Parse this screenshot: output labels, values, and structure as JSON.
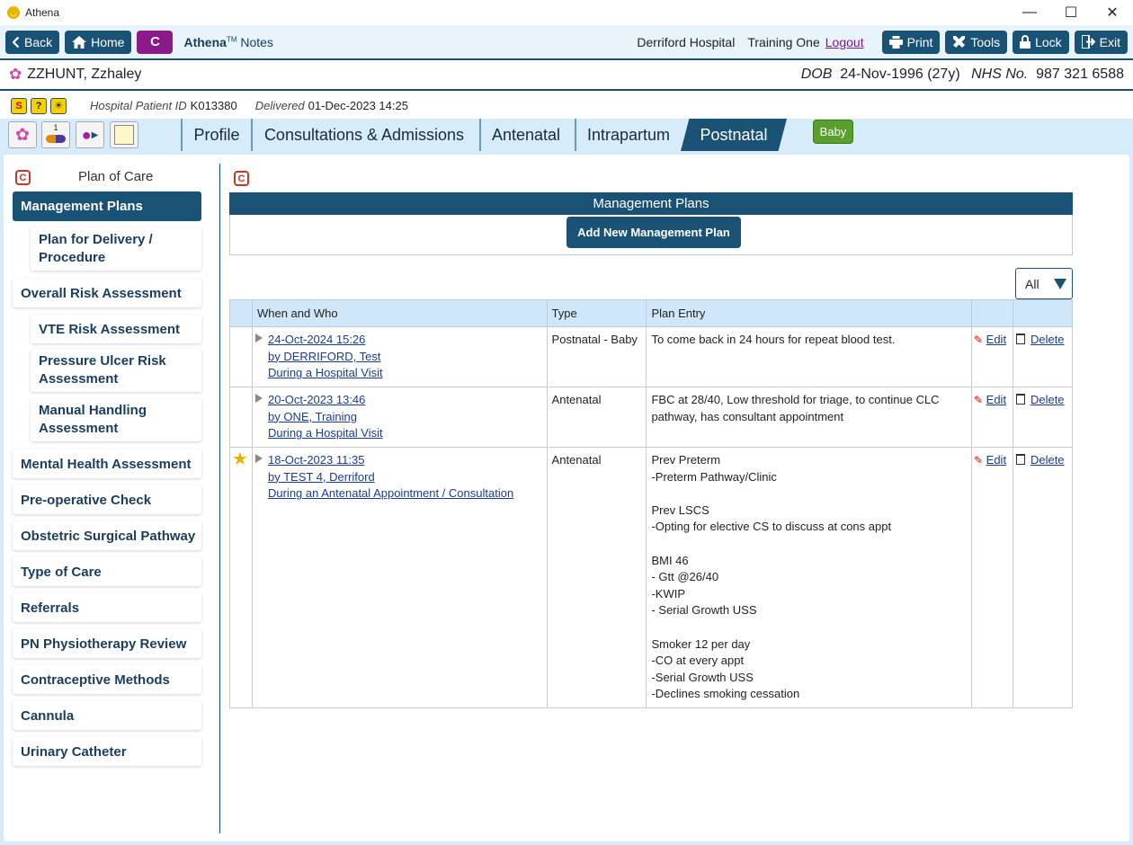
{
  "window": {
    "title": "Athena"
  },
  "toolbar": {
    "back": "Back",
    "home": "Home",
    "c": "C",
    "brand_name": "Athena",
    "brand_tm": "TM",
    "brand_suffix": "Notes",
    "hospital": "Derriford Hospital",
    "user": "Training One",
    "logout": "Logout",
    "print": "Print",
    "tools": "Tools",
    "lock": "Lock",
    "exit": "Exit"
  },
  "patient": {
    "name": "ZZHUNT, Zzhaley",
    "dob_label": "DOB",
    "dob": "24-Nov-1996 (27y)",
    "nhs_label": "NHS No.",
    "nhs": "987 321 6588",
    "hospital_id_label": "Hospital Patient ID",
    "hospital_id": "K013380",
    "delivered_label": "Delivered",
    "delivered": "01-Dec-2023 14:25"
  },
  "tabs": [
    {
      "label": "Profile"
    },
    {
      "label": "Consultations & Admissions"
    },
    {
      "label": "Antenatal"
    },
    {
      "label": "Intrapartum"
    },
    {
      "label": "Postnatal"
    }
  ],
  "baby_button": "Baby",
  "sidebar": {
    "title": "Plan of Care",
    "items": [
      "Management Plans",
      "Plan for Delivery / Procedure",
      "Overall Risk Assessment",
      "VTE Risk Assessment",
      "Pressure Ulcer Risk Assessment",
      "Manual Handling Assessment",
      "Mental Health Assessment",
      "Pre-operative Check",
      "Obstetric Surgical Pathway",
      "Type of Care",
      "Referrals",
      "PN Physiotherapy Review",
      "Contraceptive Methods",
      "Cannula",
      "Urinary Catheter"
    ]
  },
  "main": {
    "header": "Management Plans",
    "add_button": "Add New Management Plan",
    "filter": "All",
    "columns": [
      "When and Who",
      "Type",
      "Plan Entry"
    ],
    "edit_label": "Edit",
    "delete_label": "Delete",
    "rows": [
      {
        "starred": false,
        "when": "24-Oct-2024 15:26",
        "who": "by DERRIFORD, Test",
        "context": "During a Hospital Visit",
        "type": "Postnatal - Baby",
        "entry": "To come back in 24 hours for repeat blood test."
      },
      {
        "starred": false,
        "when": "20-Oct-2023 13:46",
        "who": "by ONE, Training",
        "context": "During a Hospital Visit",
        "type": "Antenatal",
        "entry": "FBC at 28/40, Low threshold for triage, to continue CLC pathway, has consultant appointment"
      },
      {
        "starred": true,
        "when": "18-Oct-2023 11:35",
        "who": "by TEST 4, Derriford",
        "context": "During an Antenatal Appointment / Consultation",
        "type": "Antenatal",
        "entry_lines": [
          "Prev Preterm",
          "-Preterm Pathway/Clinic",
          "",
          "Prev LSCS",
          "-Opting for elective CS to discuss at cons appt",
          "",
          "BMI 46",
          "- Gtt @26/40",
          "-KWIP",
          "- Serial Growth USS",
          "",
          "Smoker 12 per day",
          "-CO at every appt",
          "-Serial Growth USS",
          "-Declines smoking cessation"
        ]
      }
    ]
  }
}
